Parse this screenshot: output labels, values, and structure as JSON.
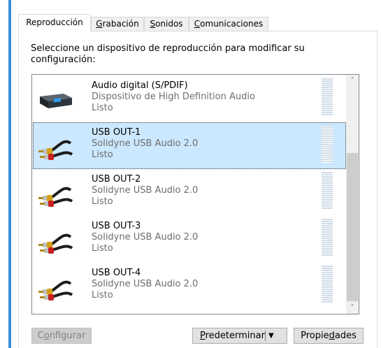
{
  "tabs": [
    {
      "label": "Reproducción",
      "active": true
    },
    {
      "label_pre": "",
      "label_u": "G",
      "label_post": "rabación"
    },
    {
      "label_pre": "",
      "label_u": "S",
      "label_post": "onidos"
    },
    {
      "label_pre": "",
      "label_u": "C",
      "label_post": "omunicaciones"
    }
  ],
  "instruction": "Seleccione un dispositivo de reproducción para modificar su configuración:",
  "devices": [
    {
      "name": "Audio digital (S/PDIF)",
      "description": "Dispositivo de High Definition Audio",
      "status": "Listo",
      "icon": "spdif-device-icon"
    },
    {
      "name": "USB OUT-1",
      "description": "Solidyne USB Audio 2.0",
      "status": "Listo",
      "icon": "rca-cable-icon",
      "selected": true
    },
    {
      "name": "USB OUT-2",
      "description": "Solidyne USB Audio 2.0",
      "status": "Listo",
      "icon": "rca-cable-icon"
    },
    {
      "name": "USB OUT-3",
      "description": "Solidyne USB Audio 2.0",
      "status": "Listo",
      "icon": "rca-cable-icon"
    },
    {
      "name": "USB OUT-4",
      "description": "Solidyne USB Audio 2.0",
      "status": "Listo",
      "icon": "rca-cable-icon"
    }
  ],
  "scroll": {
    "up_glyph": "˄",
    "down_glyph": "˅"
  },
  "buttons": {
    "configure": {
      "pre": "C",
      "u": "o",
      "post": "nfigurar"
    },
    "set_default": {
      "pre": "",
      "u": "P",
      "post": "redeterminar",
      "arrow": "▼"
    },
    "properties": {
      "pre": "Propie",
      "u": "d",
      "post": "ades"
    }
  },
  "colors": {
    "selection": "#cce8ff",
    "window_edge": "#3a8fd8"
  }
}
